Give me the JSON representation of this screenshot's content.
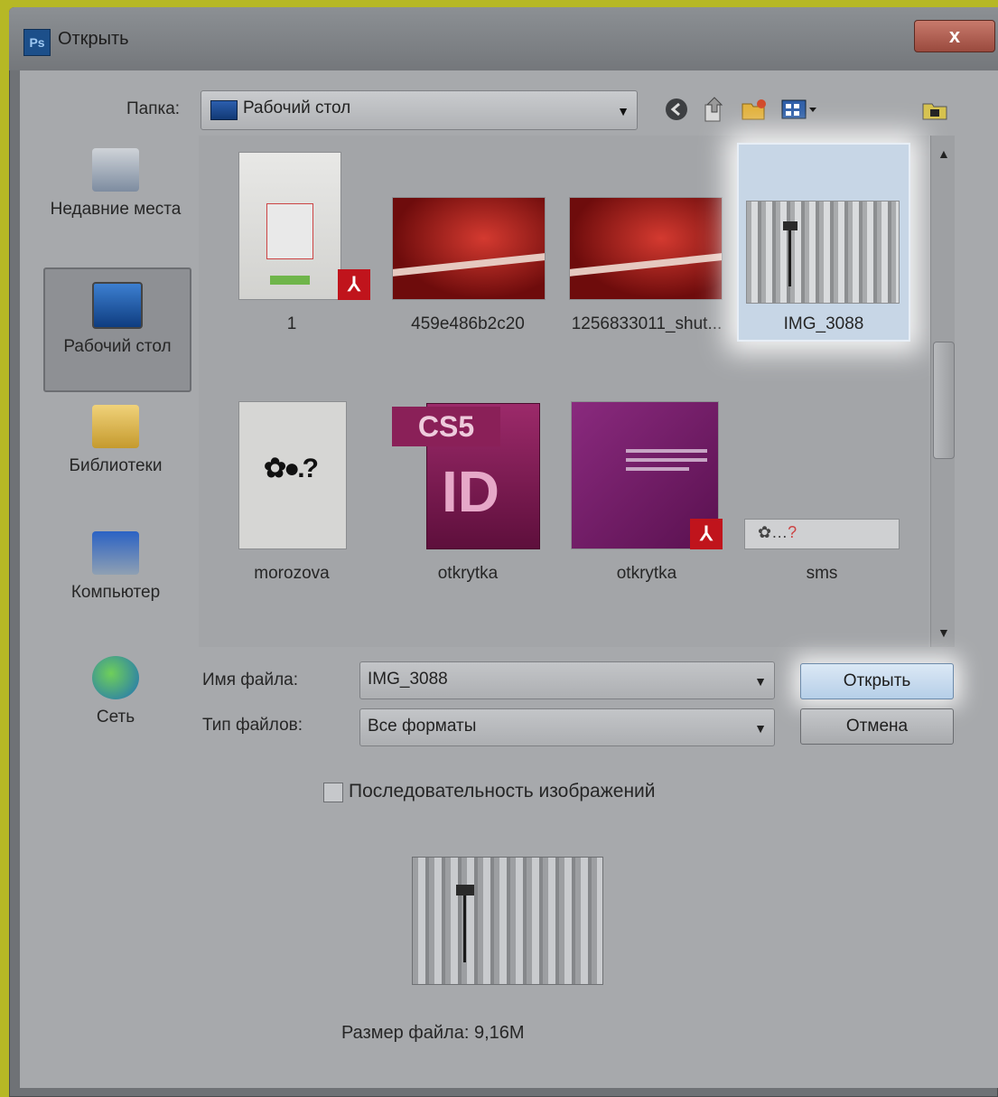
{
  "window": {
    "title": "Открыть",
    "app_icon_text": "Ps",
    "close_label": "x"
  },
  "folder": {
    "label": "Папка:",
    "current": "Рабочий стол"
  },
  "toolbar_icons": [
    "back-icon",
    "up-folder-icon",
    "new-folder-icon",
    "view-menu-icon",
    "folder-action-icon"
  ],
  "sidebar": {
    "items": [
      {
        "label": "Недавние места",
        "icon": "recent-places-icon",
        "selected": false
      },
      {
        "label": "Рабочий стол",
        "icon": "desktop-icon",
        "selected": true
      },
      {
        "label": "Библиотеки",
        "icon": "libraries-icon",
        "selected": false
      },
      {
        "label": "Компьютер",
        "icon": "computer-icon",
        "selected": false
      },
      {
        "label": "Сеть",
        "icon": "network-icon",
        "selected": false
      }
    ]
  },
  "files": [
    {
      "name": "1",
      "type": "pdf"
    },
    {
      "name": "459e486b2c20",
      "type": "image"
    },
    {
      "name": "1256833011_shut...",
      "type": "image"
    },
    {
      "name": "IMG_3088",
      "type": "image",
      "selected": true
    },
    {
      "name": "morozova",
      "type": "image"
    },
    {
      "name": "otkrytka",
      "type": "indesign",
      "badge": "CS5",
      "letters": "ID"
    },
    {
      "name": "otkrytka",
      "type": "pdf"
    },
    {
      "name": "sms",
      "type": "image"
    }
  ],
  "filename": {
    "label": "Имя файла:",
    "value": "IMG_3088"
  },
  "filetype": {
    "label": "Тип файлов:",
    "value": "Все форматы"
  },
  "buttons": {
    "open": "Открыть",
    "cancel": "Отмена"
  },
  "sequence": {
    "label": "Последовательность изображений",
    "checked": false
  },
  "file_size": "Размер файла: 9,16M"
}
